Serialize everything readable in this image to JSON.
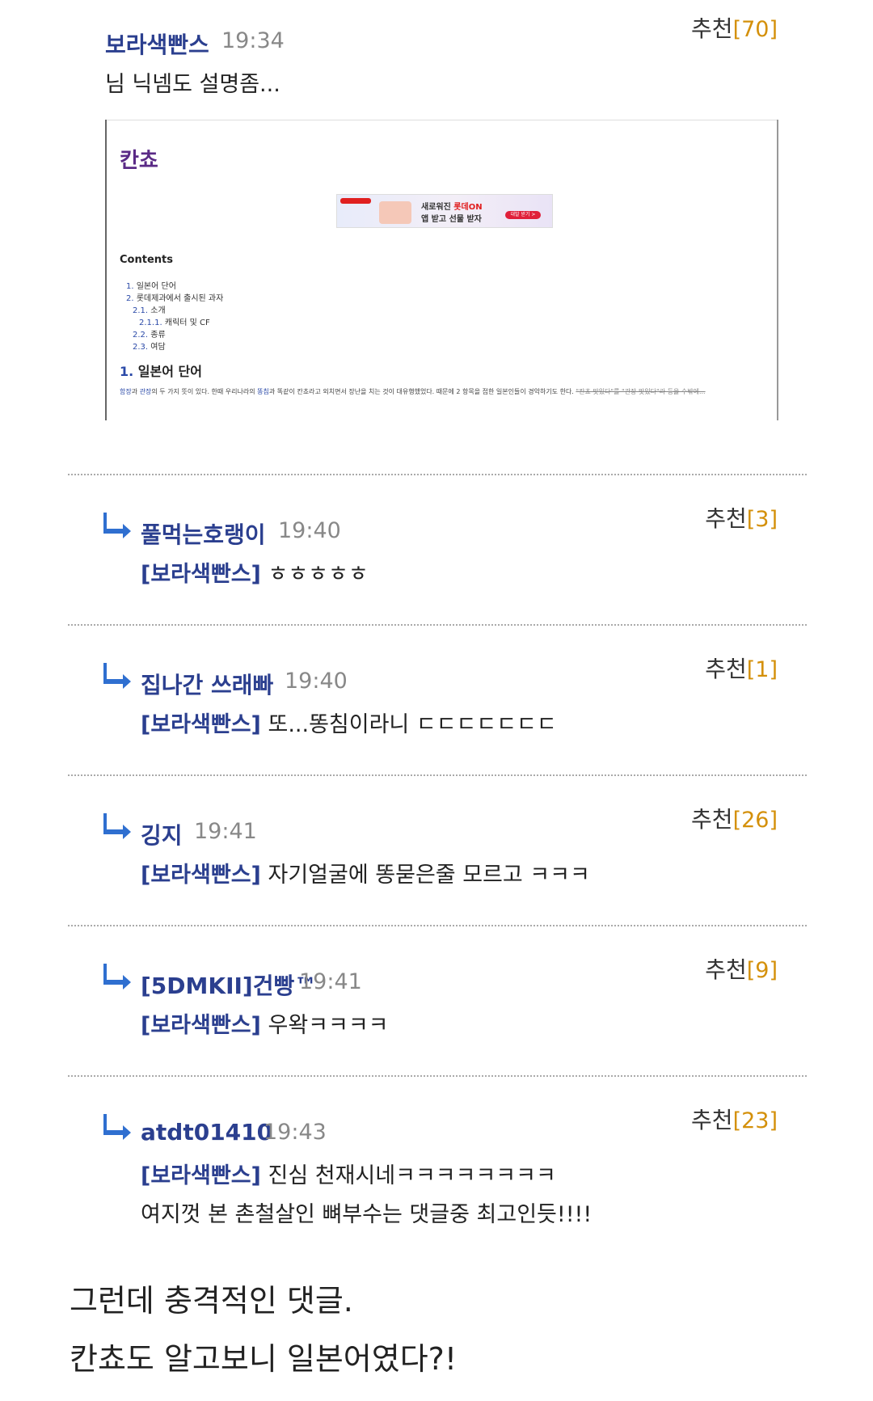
{
  "recommend_label": "추천",
  "reply_icon": "reply-arrow-icon",
  "main_comment": {
    "author": "보라색빤스",
    "time": "19:34",
    "text": "님 닉넴도 설명좀...",
    "recommend": "[70]",
    "embed": {
      "title": "칸쵸",
      "ad_line1": "새로워진",
      "ad_line1_brand": "롯데ON",
      "ad_line2": "앱 받고 선물 받자",
      "ad_button": "대발 받기 >",
      "contents_label": "Contents",
      "toc": [
        {
          "num": "1.",
          "text": "일본어 단어"
        },
        {
          "num": "2.",
          "text": "롯데제과에서 출시된 과자"
        },
        {
          "num": "2.1.",
          "text": "소개"
        },
        {
          "num": "2.1.1.",
          "text": "캐릭터 및 CF"
        },
        {
          "num": "2.2.",
          "text": "종류"
        },
        {
          "num": "2.3.",
          "text": "여담"
        }
      ],
      "section_num": "1.",
      "section_title": "일본어 단어",
      "para_link1": "함장",
      "para_t1": "과",
      "para_link2": "관장",
      "para_t2": "의 두 가지 뜻이 있다. 한때 우리나라의",
      "para_link3": "똥침",
      "para_t3": "과 똑같이 칸쵸라고 외치면서 장난을 치는 것이 대유행했었다. 때문에 2 항목을 접한 일본인들이 경악하기도 한다.",
      "para_strike": "\"칸쵸 맛있다\"를 \"관장 맛있다\"라 등을 수밖에..."
    }
  },
  "replies": [
    {
      "author": "풀먹는호랭이",
      "time": "19:40",
      "mention": "[보라색빤스]",
      "text": "ㅎㅎㅎㅎㅎ",
      "recommend": "[3]"
    },
    {
      "author": "집나간 쓰래빠",
      "time": "19:40",
      "mention": "[보라색빤스]",
      "text": "또...똥침이라니 ㄷㄷㄷㄷㄷㄷㄷ",
      "recommend": "[1]"
    },
    {
      "author": "깅지",
      "time": "19:41",
      "mention": "[보라색빤스]",
      "text": "자기얼굴에 똥묻은줄 모르고 ㅋㅋㅋ",
      "recommend": "[26]"
    },
    {
      "author": "[5DMKII]건빵™",
      "time": "19:41",
      "mention": "[보라색빤스]",
      "text": "우왁ㅋㅋㅋㅋ",
      "recommend": "[9]"
    },
    {
      "author": "atdt01410",
      "time": "19:43",
      "mention": "[보라색빤스]",
      "text": "진심 천재시네ㅋㅋㅋㅋㅋㅋㅋㅋ",
      "text2": "여지껏 본 촌철살인 뼈부수는 댓글중 최고인듯!!!!",
      "recommend": "[23]"
    }
  ],
  "footer": {
    "line1": "그런데 충격적인 댓글.",
    "line2": "칸쵸도 알고보니 일본어였다?!"
  }
}
